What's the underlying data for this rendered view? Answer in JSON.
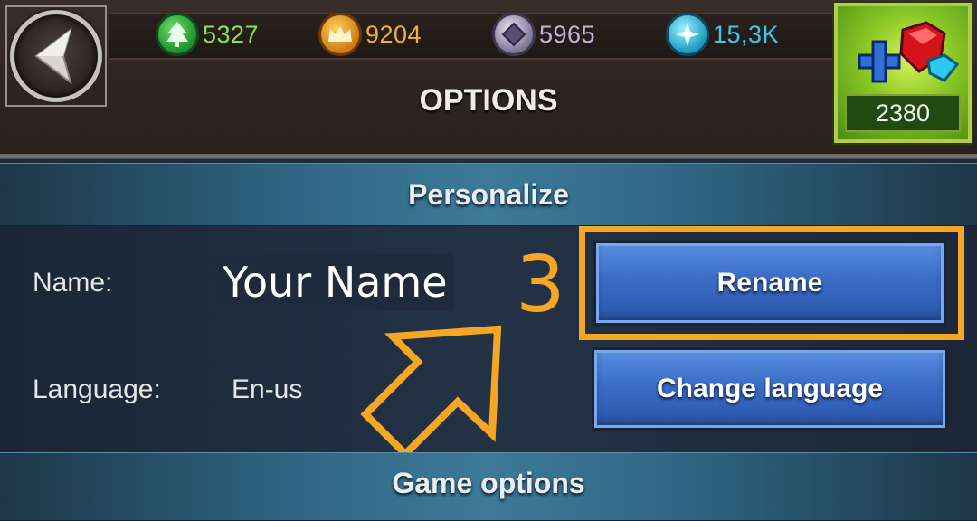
{
  "header": {
    "title": "OPTIONS",
    "back_icon": "back-arrow-icon",
    "resources": [
      {
        "name": "tree-icon",
        "value": "5327",
        "color": "#8fe04a"
      },
      {
        "name": "crown-icon",
        "value": "9204",
        "color": "#f0b030"
      },
      {
        "name": "crystal-icon",
        "value": "5965",
        "color": "#c0b6d6"
      },
      {
        "name": "star-icon",
        "value": "15,3K",
        "color": "#3cc8ea"
      }
    ],
    "gems": {
      "icon": "gem-plus-icon",
      "value": "2380"
    }
  },
  "personalize": {
    "heading": "Personalize",
    "name_label": "Name:",
    "name_value": "Your Name",
    "language_label": "Language:",
    "language_value": "En-us",
    "rename_button": "Rename",
    "change_language_button": "Change language"
  },
  "annotation": {
    "step_number": "3",
    "highlight_color": "#f5a623",
    "arrow_icon": "pointer-arrow-icon"
  },
  "game_options": {
    "heading": "Game options"
  }
}
